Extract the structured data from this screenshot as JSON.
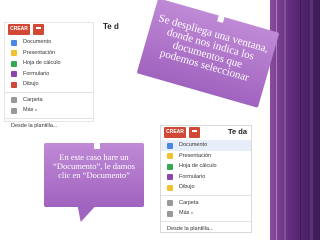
{
  "menu_top": {
    "create_label": "CREAR",
    "partial_title": "Te d",
    "items": [
      {
        "label": "Documento",
        "icon": "document-icon",
        "color": "#4a86e8"
      },
      {
        "label": "Presentación",
        "icon": "presentation-icon",
        "color": "#f1c232"
      },
      {
        "label": "Hoja de cálculo",
        "icon": "spreadsheet-icon",
        "color": "#34a853"
      },
      {
        "label": "Formulario",
        "icon": "form-icon",
        "color": "#8e44ad"
      },
      {
        "label": "Dibujo",
        "icon": "drawing-icon",
        "color": "#d14836"
      },
      {
        "label": "Carpeta",
        "icon": "folder-icon",
        "color": "#999999"
      },
      {
        "label": "Más",
        "icon": "more-icon",
        "color": "#999999"
      }
    ],
    "footer": "Desde la plantilla..."
  },
  "menu_bottom": {
    "create_label": "CREAR",
    "partial_title": "Te da",
    "items": [
      {
        "label": "Documento",
        "icon": "document-icon",
        "color": "#4a86e8",
        "selected": true
      },
      {
        "label": "Presentación",
        "icon": "presentation-icon",
        "color": "#f1c232"
      },
      {
        "label": "Hoja de cálculo",
        "icon": "spreadsheet-icon",
        "color": "#34a853"
      },
      {
        "label": "Formulario",
        "icon": "form-icon",
        "color": "#8e44ad"
      },
      {
        "label": "Dibujo",
        "icon": "drawing-icon",
        "color": "#f1c232"
      },
      {
        "label": "Carpeta",
        "icon": "folder-icon",
        "color": "#999999"
      },
      {
        "label": "Más",
        "icon": "more-icon",
        "color": "#999999"
      }
    ],
    "footer": "Desde la plantilla..."
  },
  "callouts": {
    "top": "Se despliega una ventana, donde nos indica los documentos que podemos seleccionar",
    "bottom": "En este caso hare un “Documento”, le damos clic en “Documento”"
  },
  "colors": {
    "accent_red": "#d14836",
    "callout_purple": "#a866c4",
    "band_purple": "#5e2a7a"
  }
}
